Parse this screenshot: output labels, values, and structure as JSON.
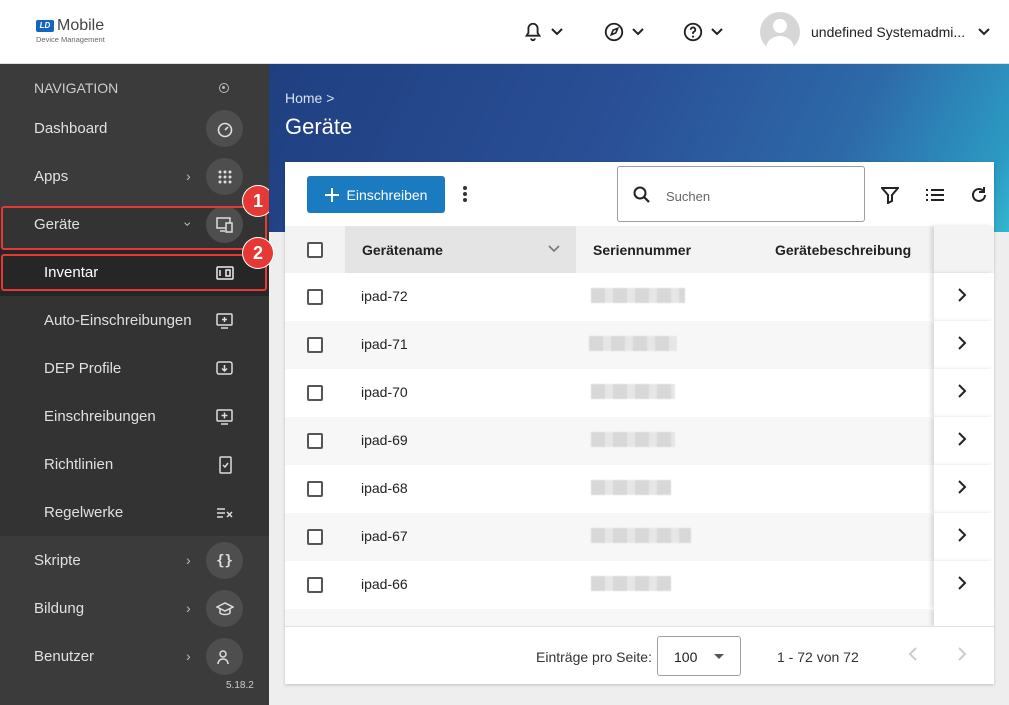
{
  "app": {
    "logo_badge": "LD",
    "logo_main": "Mobile",
    "logo_sub": "Device Management"
  },
  "topbar": {
    "notifications_icon": "bell-icon",
    "compass_icon": "compass-icon",
    "help_icon": "help-icon",
    "user_name": "undefined Systemadmi..."
  },
  "sidebar": {
    "header": "NAVIGATION",
    "items": [
      {
        "label": "Dashboard",
        "icon": "speedometer-icon"
      },
      {
        "label": "Apps",
        "icon": "grid-icon"
      },
      {
        "label": "Geräte",
        "icon": "devices-icon"
      },
      {
        "label": "Inventar",
        "icon": "inventory-icon"
      },
      {
        "label": "Auto-Einschreibungen",
        "icon": "auto-enroll-icon"
      },
      {
        "label": "DEP Profile",
        "icon": "download-icon"
      },
      {
        "label": "Einschreibungen",
        "icon": "enroll-icon"
      },
      {
        "label": "Richtlinien",
        "icon": "policy-icon"
      },
      {
        "label": "Regelwerke",
        "icon": "rules-icon"
      },
      {
        "label": "Skripte",
        "icon": "braces-icon"
      },
      {
        "label": "Bildung",
        "icon": "graduation-icon"
      },
      {
        "label": "Benutzer",
        "icon": "users-icon"
      }
    ],
    "version": "5.18.2",
    "annotations": [
      "1",
      "2"
    ]
  },
  "header": {
    "breadcrumb": "Home >",
    "title": "Geräte"
  },
  "toolbar": {
    "enroll_label": "Einschreiben",
    "search_placeholder": "Suchen"
  },
  "table": {
    "columns": [
      "Gerätename",
      "Seriennummer",
      "Gerätebeschreibung"
    ],
    "rows": [
      "ipad-72",
      "ipad-71",
      "ipad-70",
      "ipad-69",
      "ipad-68",
      "ipad-67",
      "ipad-66"
    ]
  },
  "footer": {
    "per_page_label": "Einträge pro Seite:",
    "per_page_value": "100",
    "range": "1 - 72 von 72"
  },
  "colors": {
    "accent": "#1b7bc0",
    "sidebar": "#3b3b3b",
    "highlight": "#e53935"
  }
}
